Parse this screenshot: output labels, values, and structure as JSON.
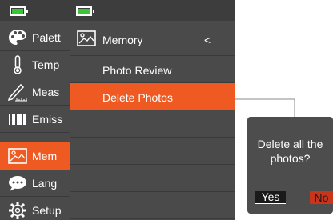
{
  "colors": {
    "screen_bg": "#4a4a4a",
    "status_bar": "#3d3d3d",
    "accent": "#ef5a22",
    "battery_fill": "#39c635",
    "dialog_bg": "#4d4d4d",
    "no_button": "#c8351b"
  },
  "main_menu": {
    "items": [
      {
        "label": "Palett",
        "icon": "palette-icon"
      },
      {
        "label": "Temp",
        "icon": "thermometer-icon"
      },
      {
        "label": "Meas",
        "icon": "measure-pen-icon"
      },
      {
        "label": "Emiss",
        "icon": "emissivity-bars-icon"
      },
      {
        "label": "Mem",
        "icon": "image-icon",
        "selected": true
      },
      {
        "label": "Lang",
        "icon": "chat-bubble-icon"
      },
      {
        "label": "Setup",
        "icon": "gear-icon"
      }
    ]
  },
  "submenu": {
    "title": "Memory",
    "icon": "image-icon",
    "back_symbol": "<",
    "items": [
      {
        "label": "Photo Review"
      },
      {
        "label": "Delete Photos",
        "selected": true
      }
    ]
  },
  "dialog": {
    "message_line1": "Delete all the",
    "message_line2": "photos?",
    "yes_label": "Yes",
    "no_label": "No"
  }
}
